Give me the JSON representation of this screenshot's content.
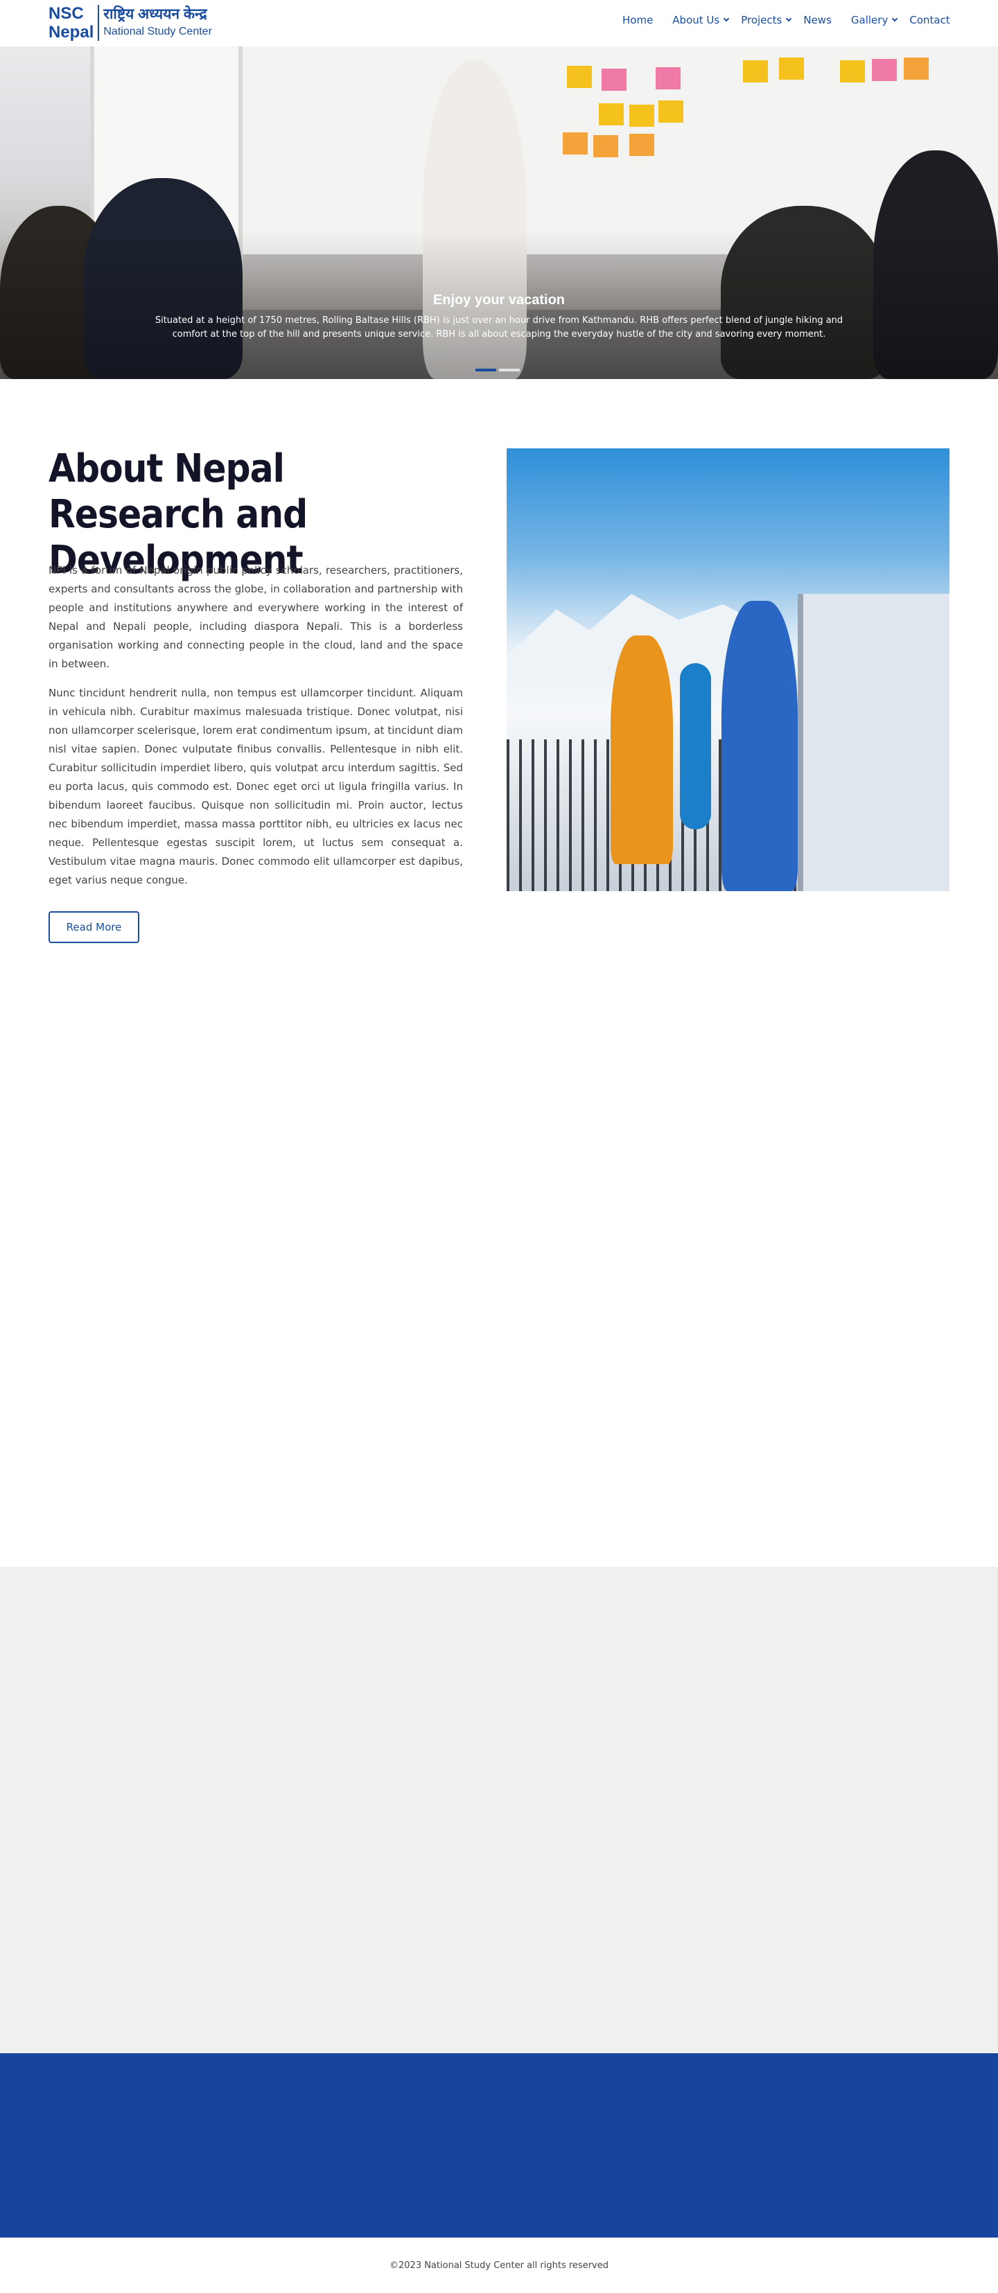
{
  "header": {
    "logo_abbr_line1": "NSC",
    "logo_abbr_line2": "Nepal",
    "logo_devanagari": "राष्ट्रिय अध्ययन केन्द्र",
    "logo_english": "National Study Center",
    "nav": {
      "home": "Home",
      "about": "About Us",
      "projects": "Projects",
      "news": "News",
      "gallery": "Gallery",
      "contact": "Contact"
    }
  },
  "hero": {
    "title": "Enjoy your vacation",
    "text": "Situated at a height of 1750 metres, Rolling Baltase Hills (RBH) is just over an hour drive from Kathmandu. RHB offers perfect blend of jungle hiking and comfort at the top of the hill and presents unique service. RBH is all about escaping the everyday hustle of the city and savoring every moment.",
    "slide_count": 3,
    "active_slide": 1
  },
  "about": {
    "title": "About Nepal Research and Development",
    "paragraph1": "NPI is a forum of Nepal origin public policy scholars, researchers, practitioners, experts and consultants across the globe, in collaboration and partnership with people and institutions anywhere and everywhere working in the interest of Nepal and Nepali people, including diaspora Nepali. This is a borderless organisation working and connecting people in the cloud, land and the space in between.",
    "paragraph2": "Nunc tincidunt hendrerit nulla, non tempus est ullamcorper tincidunt. Aliquam in vehicula nibh. Curabitur maximus malesuada tristique. Donec volutpat, nisi non ullamcorper scelerisque, lorem erat condimentum ipsum, at tincidunt diam nisl vitae sapien. Donec vulputate finibus convallis. Pellentesque in nibh elit. Curabitur sollicitudin imperdiet libero, quis volutpat arcu interdum sagittis. Sed eu porta lacus, quis commodo est. Donec eget orci ut ligula fringilla varius. In bibendum laoreet faucibus. Quisque non sollicitudin mi. Proin auctor, lectus nec bibendum imperdiet, massa massa porttitor nibh, eu ultricies ex lacus nec neque. Pellentesque egestas suscipit lorem, ut luctus sem consequat a. Vestibulum vitae magna mauris. Donec commodo elit ullamcorper est dapibus, eget varius neque congue.",
    "read_more": "Read More"
  },
  "footer": {
    "copyright": "©2023 National Study Center all rights reserved"
  },
  "colors": {
    "brand_blue": "#1a4da0",
    "footer_blue": "#17459e",
    "gray_band": "#f0f0f0",
    "heading": "#141428"
  }
}
